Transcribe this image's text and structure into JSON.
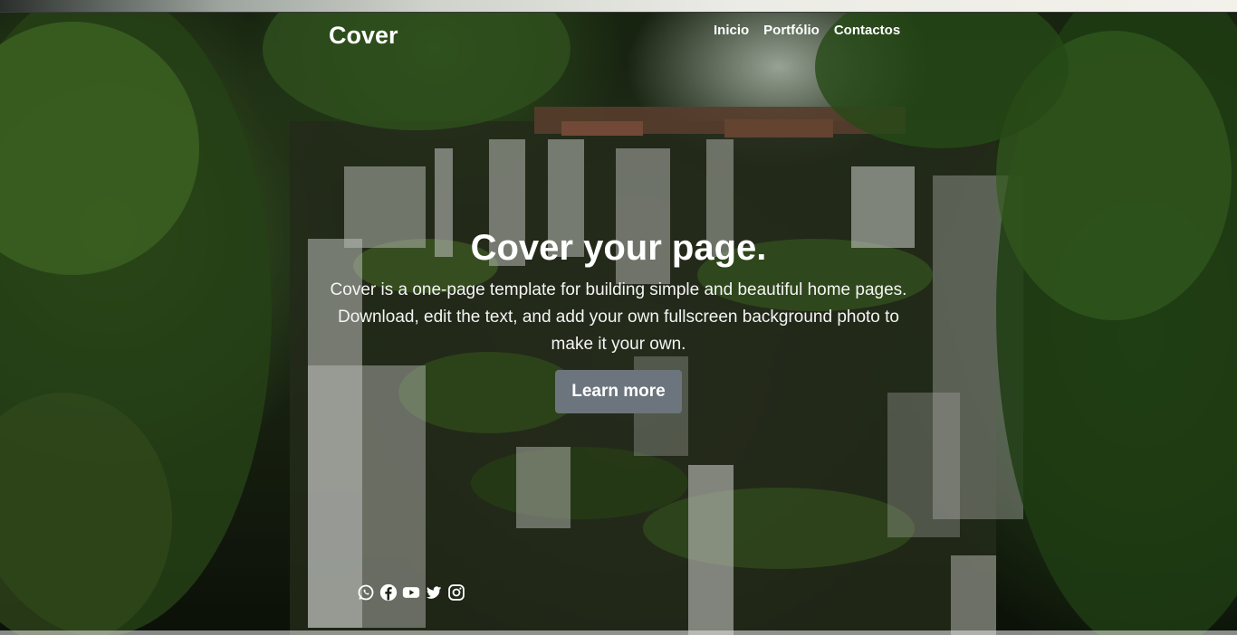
{
  "header": {
    "brand": "Cover",
    "nav": [
      "Inicio",
      "Portfólio",
      "Contactos"
    ]
  },
  "hero": {
    "title": "Cover your page.",
    "lines": [
      "Cover is a one-page template for building simple and beautiful home pages.",
      "Download, edit the text, and add your own fullscreen background photo to",
      "make it your own."
    ],
    "cta_label": "Learn more"
  },
  "social_icons": [
    "whatsapp-icon",
    "facebook-icon",
    "youtube-icon",
    "twitter-icon",
    "instagram-icon"
  ],
  "colors": {
    "button_bg": "#6c757d",
    "text": "#ffffff",
    "foliage": "#2f5a1e"
  }
}
